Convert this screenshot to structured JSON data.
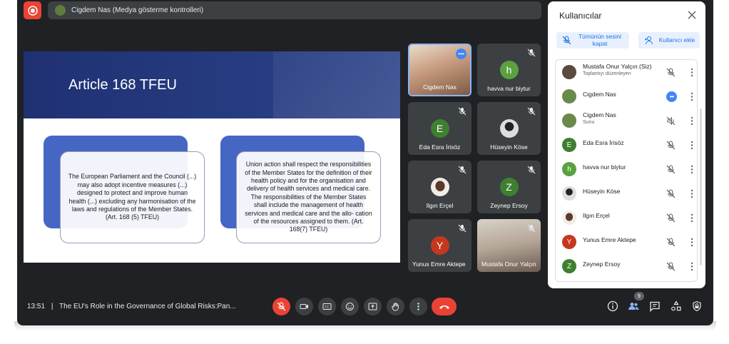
{
  "presenter_bar": {
    "label": "Cigdem Nas (Medya gösterme kontrolleri)"
  },
  "slide": {
    "title": "Article 168 TFEU",
    "box_left": "The European Parliament and the Council (...) may also adopt incentive measures (...) designed to protect and improve human health (...) excluding any harmonisation of the laws and regulations of the Member States. (Art. 168 (5) TFEU)",
    "box_right": "Union action shall respect the responsibilities of the Member States for the definition of their health policy and for the organisation and delivery of health services and medical care. The responsibilities of the Member States shall include the management of health services and medical care and the allo- cation of the resources assigned to them. (Art. 168(7) TFEU)"
  },
  "tiles": [
    {
      "name": "Cigdem Nas",
      "initial": "",
      "color": "#b88a6a"
    },
    {
      "name": "havva nur biytur",
      "initial": "h",
      "color": "#5ba13f"
    },
    {
      "name": "Eda Esra İrisöz",
      "initial": "E",
      "color": "#3e7f30"
    },
    {
      "name": "Hüseyin Köse",
      "initial": "",
      "color": "#d5d5d5"
    },
    {
      "name": "Ilgın Erçel",
      "initial": "",
      "color": "#e9e4e0"
    },
    {
      "name": "Zeynep Ersoy",
      "initial": "Z",
      "color": "#3e7f30"
    },
    {
      "name": "Yunus Emre Aktepe",
      "initial": "Y",
      "color": "#c5381f"
    },
    {
      "name": "Mustafa Onur Yalçın",
      "initial": "",
      "color": "#8a7b70"
    }
  ],
  "panel": {
    "title": "Kullanıcılar",
    "mute_all": "Tümünün sesini kapat",
    "add_user": "Kullanıcı ekle",
    "people": [
      {
        "name": "Mustafa Onur Yalçın (Siz)",
        "sub": "Toplantıyı düzenleyen",
        "initial": "",
        "color": "#5a4a40"
      },
      {
        "name": "Cigdem Nas",
        "sub": "",
        "initial": "",
        "color": "#6a8a4a"
      },
      {
        "name": "Cigdem Nas",
        "sub": "Sunu",
        "initial": "",
        "color": "#6a8a4a"
      },
      {
        "name": "Eda Esra İrisöz",
        "sub": "",
        "initial": "E",
        "color": "#3e7f30"
      },
      {
        "name": "havva nur biytur",
        "sub": "",
        "initial": "h",
        "color": "#5ba13f"
      },
      {
        "name": "Hüseyin Köse",
        "sub": "",
        "initial": "",
        "color": "#cfcfcf"
      },
      {
        "name": "Ilgın Erçel",
        "sub": "",
        "initial": "",
        "color": "#e4ddd8"
      },
      {
        "name": "Yunus Emre Aktepe",
        "sub": "",
        "initial": "Y",
        "color": "#c5381f"
      },
      {
        "name": "Zeynep Ersoy",
        "sub": "",
        "initial": "Z",
        "color": "#3e7f30"
      }
    ]
  },
  "bottom": {
    "time": "13:51",
    "separator": "|",
    "meeting_title": "The EU's Role in the Governance of Global Risks:Pan...",
    "participant_count": "9"
  },
  "colors": {
    "bar_bg": "#202124",
    "control_bg": "#3c4043",
    "red": "#ea4335",
    "accent_blue": "#1a73e8"
  }
}
